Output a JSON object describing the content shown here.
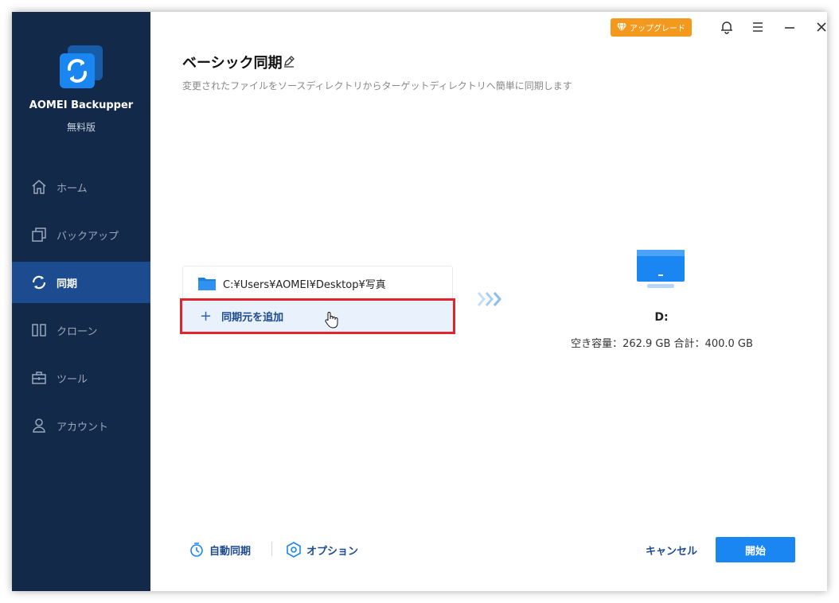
{
  "app": {
    "name": "AOMEI Backupper",
    "edition": "無料版"
  },
  "sidebar": {
    "items": [
      {
        "label": "ホーム",
        "icon": "home-icon"
      },
      {
        "label": "バックアップ",
        "icon": "backup-icon"
      },
      {
        "label": "同期",
        "icon": "sync-icon",
        "active": true
      },
      {
        "label": "クローン",
        "icon": "clone-icon"
      },
      {
        "label": "ツール",
        "icon": "tools-icon"
      },
      {
        "label": "アカウント",
        "icon": "account-icon"
      }
    ]
  },
  "header": {
    "upgrade_label": "アップグレード",
    "title": "ベーシック同期",
    "subtitle": "変更されたファイルをソースディレクトリからターゲットディレクトリへ簡単に同期します"
  },
  "source": {
    "path": "C:¥Users¥AOMEI¥Desktop¥写真",
    "add_label": "同期元を追加"
  },
  "target": {
    "drive": "D:",
    "space": "空き容量：262.9 GB 合計：400.0 GB"
  },
  "footer": {
    "auto_sync_label": "自動同期",
    "options_label": "オプション",
    "cancel_label": "キャンセル",
    "start_label": "開始"
  },
  "colors": {
    "sidebar_bg": "#13294a",
    "sidebar_active": "#1d4b8f",
    "accent": "#1a86f2",
    "upgrade": "#f39a1e",
    "highlight_border": "#e0262d"
  }
}
